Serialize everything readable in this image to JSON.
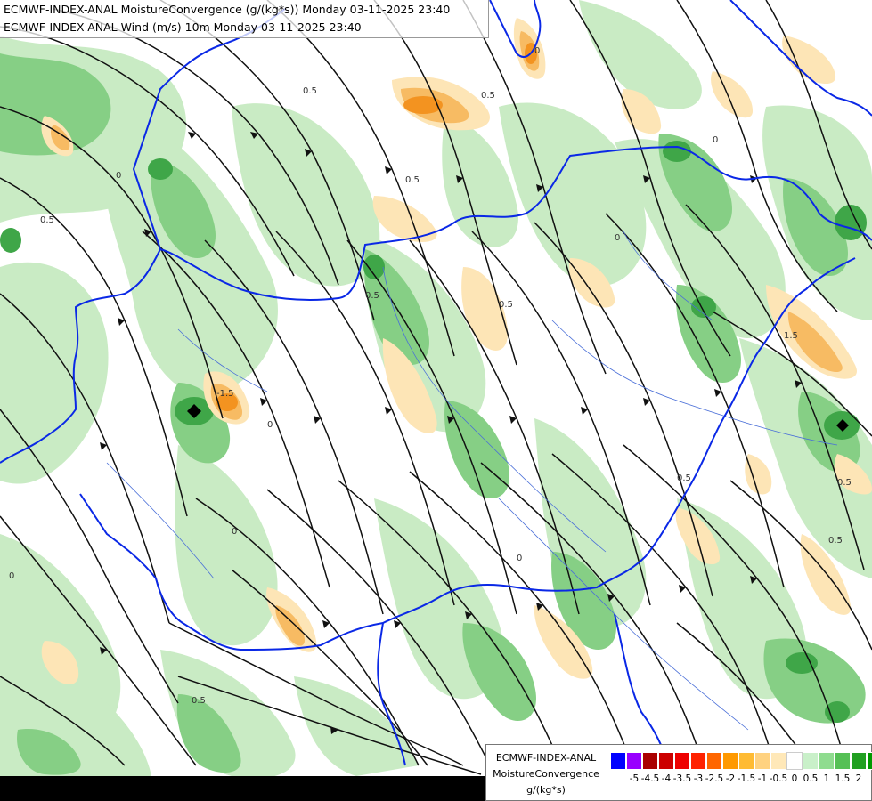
{
  "map": {
    "title_line1": "ECMWF-INDEX-ANAL MoistureConvergence (g/(kg*s)) Monday 03-11-2025 23:40",
    "title_line2": "ECMWF-INDEX-ANAL Wind (m/s) 10m Monday 03-11-2025 23:40",
    "legend": {
      "title_line1": "ECMWF-INDEX-ANAL",
      "title_line2": "MoistureConvergence",
      "title_line3": "g/(kg*s)",
      "colors": [
        "#0000ff",
        "#9900ff",
        "#aa0000",
        "#cc0000",
        "#ee0000",
        "#ff2200",
        "#ff6600",
        "#ff9900",
        "#ffbb33",
        "#ffd280",
        "#ffe8b8",
        "#ffffff",
        "#c9f0c9",
        "#8fdc8f",
        "#55c055",
        "#22a022",
        "#009900"
      ],
      "tick_labels": [
        "-5",
        "-4.5",
        "-4",
        "-3.5",
        "-3",
        "-2.5",
        "-2",
        "-1.5",
        "-1",
        "-0.5",
        "0",
        "0.5",
        "1",
        "1.5",
        "2"
      ]
    },
    "contour_labels": [
      "0",
      "0.5",
      "-1.5",
      "1.5"
    ],
    "palette": {
      "convergence_light": "#c9ebc4",
      "convergence_mid": "#86cf85",
      "convergence_strong": "#3fa648",
      "divergence_light": "#fde5b6",
      "divergence_mid": "#f7bb63",
      "divergence_strong": "#f39320",
      "border": "#0a28e6",
      "river": "#4a6fd8",
      "streamline": "#111111"
    }
  }
}
